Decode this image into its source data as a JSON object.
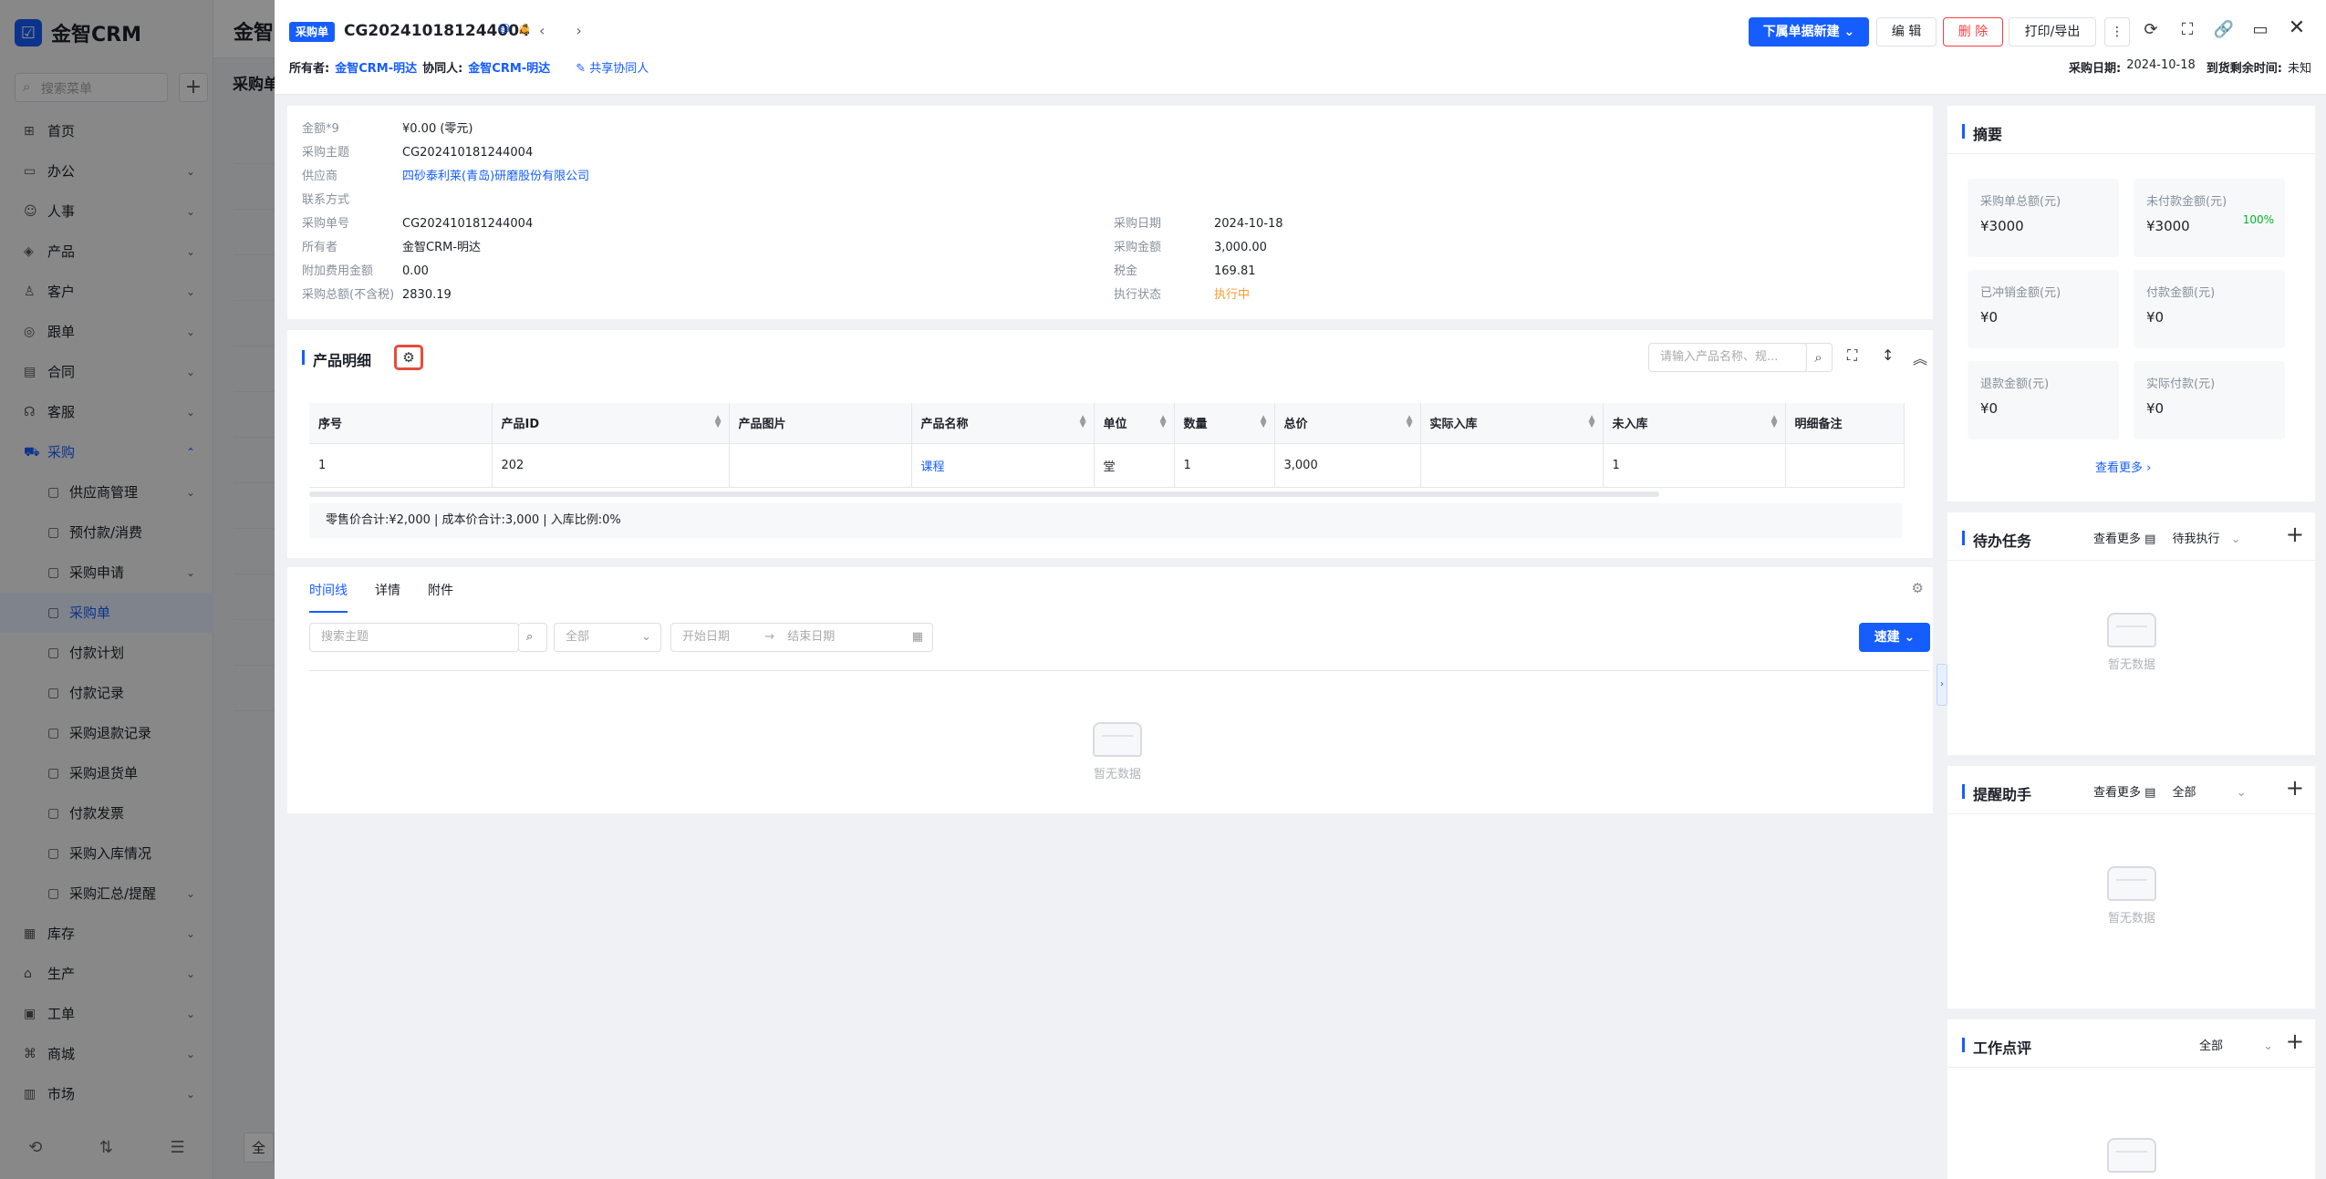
{
  "app": {
    "name": "金智CRM",
    "bg_title": "金智",
    "bg_subtitle": "采购单",
    "bg_footer": "全",
    "side_search_placeholder": "搜索菜单",
    "menu": [
      {
        "label": "首页",
        "icon": "grid-icon"
      },
      {
        "label": "办公",
        "icon": "briefcase-icon",
        "chev": "⌄"
      },
      {
        "label": "人事",
        "icon": "people-icon",
        "chev": "⌄"
      },
      {
        "label": "产品",
        "icon": "cube-icon",
        "chev": "⌄"
      },
      {
        "label": "客户",
        "icon": "customer-icon",
        "chev": "⌄"
      },
      {
        "label": "跟单",
        "icon": "target-icon",
        "chev": "⌄"
      },
      {
        "label": "合同",
        "icon": "contract-icon",
        "chev": "⌄"
      },
      {
        "label": "客服",
        "icon": "headset-icon",
        "chev": "⌄"
      },
      {
        "label": "采购",
        "icon": "cart-icon",
        "chev": "⌃",
        "active": true
      },
      {
        "label": "供应商管理",
        "icon": "supplier-icon",
        "chev": "⌄",
        "sub": true
      },
      {
        "label": "预付款/消费",
        "icon": "prepay-icon",
        "sub": true
      },
      {
        "label": "采购申请",
        "icon": "request-icon",
        "chev": "⌄",
        "sub": true
      },
      {
        "label": "采购单",
        "icon": "order-icon",
        "sub": true,
        "selected": true
      },
      {
        "label": "付款计划",
        "icon": "plan-icon",
        "sub": true
      },
      {
        "label": "付款记录",
        "icon": "record-icon",
        "sub": true
      },
      {
        "label": "采购退款记录",
        "icon": "refund-icon",
        "sub": true
      },
      {
        "label": "采购退货单",
        "icon": "return-icon",
        "sub": true
      },
      {
        "label": "付款发票",
        "icon": "invoice-icon",
        "sub": true
      },
      {
        "label": "采购入库情况",
        "icon": "warehouse-icon",
        "sub": true
      },
      {
        "label": "采购汇总/提醒",
        "icon": "summary-icon",
        "chev": "⌄",
        "sub": true
      },
      {
        "label": "库存",
        "icon": "stock-icon",
        "chev": "⌄"
      },
      {
        "label": "生产",
        "icon": "factory-icon",
        "chev": "⌄"
      },
      {
        "label": "工单",
        "icon": "ticket-icon",
        "chev": "⌄"
      },
      {
        "label": "商城",
        "icon": "shop-icon",
        "chev": "⌄"
      },
      {
        "label": "市场",
        "icon": "market-icon",
        "chev": "⌄"
      }
    ]
  },
  "header": {
    "tag": "采购单",
    "doc_no": "CG202410181244004",
    "owner_label": "所有者:",
    "owner": "金智CRM-明达",
    "collab_label": "协同人:",
    "collab": "金智CRM-明达",
    "share": "共享协同人",
    "buttons": {
      "create_sub": "下属单据新建",
      "edit": "编 辑",
      "delete": "删 除",
      "print": "打印/导出"
    },
    "date_label": "采购日期:",
    "date": "2024-10-18",
    "remain_label": "到货剩余时间:",
    "remain": "未知"
  },
  "info": {
    "left": [
      {
        "k": "金额*9",
        "v": "¥0.00 (零元)"
      },
      {
        "k": "采购主题",
        "v": "CG202410181244004"
      },
      {
        "k": "供应商",
        "v": "四砂泰利莱(青岛)研磨股份有限公司",
        "link": true
      },
      {
        "k": "联系方式",
        "v": ""
      },
      {
        "k": "采购单号",
        "v": "CG202410181244004"
      },
      {
        "k": "所有者",
        "v": "金智CRM-明达"
      },
      {
        "k": "附加费用金额",
        "v": "0.00"
      },
      {
        "k": "采购总额(不含税)",
        "v": "2830.19"
      }
    ],
    "right": [
      {
        "k": "采购日期",
        "v": "2024-10-18"
      },
      {
        "k": "采购金额",
        "v": "3,000.00"
      },
      {
        "k": "税金",
        "v": "169.81"
      },
      {
        "k": "执行状态",
        "v": "执行中",
        "warn": true
      }
    ]
  },
  "products": {
    "title": "产品明细",
    "search_placeholder": "请输入产品名称、规...",
    "columns": [
      "序号",
      "产品ID",
      "产品图片",
      "产品名称",
      "单位",
      "数量",
      "总价",
      "实际入库",
      "未入库",
      "明细备注"
    ],
    "rows": [
      [
        "1",
        "202",
        "",
        "课程",
        "堂",
        "1",
        "3,000",
        "",
        "1",
        ""
      ]
    ],
    "summary": "零售价合计:¥2,000 |    成本价合计:3,000 |    入库比例:0%"
  },
  "timeline": {
    "tabs": [
      "时间线",
      "详情",
      "附件"
    ],
    "search_placeholder": "搜索主题",
    "select_value": "全部",
    "start_placeholder": "开始日期",
    "end_placeholder": "结束日期",
    "quick": "速建",
    "empty": "暂无数据"
  },
  "summary": {
    "title": "摘要",
    "stats": [
      {
        "label": "采购单总额(元)",
        "value": "¥3000"
      },
      {
        "label": "未付款金额(元)",
        "value": "¥3000",
        "pct": "100%"
      },
      {
        "label": "已冲销金额(元)",
        "value": "¥0"
      },
      {
        "label": "付款金额(元)",
        "value": "¥0"
      },
      {
        "label": "退款金额(元)",
        "value": "¥0"
      },
      {
        "label": "实际付款(元)",
        "value": "¥0"
      }
    ],
    "more": "查看更多"
  },
  "todo": {
    "title": "待办任务",
    "more": "查看更多",
    "filter": "待我执行",
    "empty": "暂无数据"
  },
  "reminder": {
    "title": "提醒助手",
    "more": "查看更多",
    "filter": "全部",
    "empty": "暂无数据"
  },
  "review": {
    "title": "工作点评",
    "filter": "全部"
  }
}
